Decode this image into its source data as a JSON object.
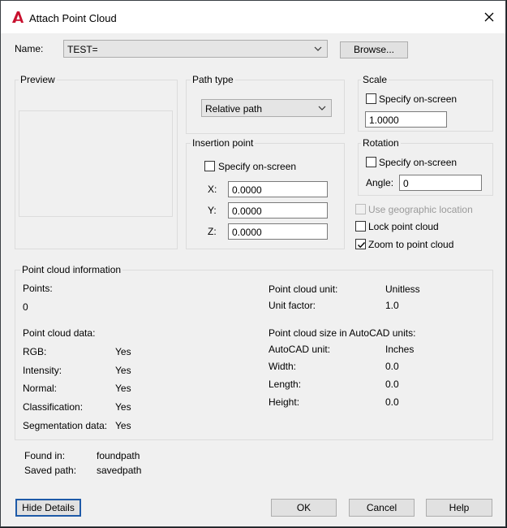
{
  "window": {
    "title": "Attach Point Cloud"
  },
  "name_row": {
    "label": "Name:",
    "value": "TEST=",
    "browse_label": "Browse..."
  },
  "preview": {
    "label": "Preview"
  },
  "path_type": {
    "label": "Path type",
    "value": "Relative path"
  },
  "insertion_point": {
    "label": "Insertion point",
    "specify_label": "Specify on-screen",
    "x_label": "X:",
    "x_value": "0.0000",
    "y_label": "Y:",
    "y_value": "0.0000",
    "z_label": "Z:",
    "z_value": "0.0000"
  },
  "scale": {
    "label": "Scale",
    "specify_label": "Specify on-screen",
    "value": "1.0000"
  },
  "rotation": {
    "label": "Rotation",
    "specify_label": "Specify on-screen",
    "angle_label": "Angle:",
    "angle_value": "0"
  },
  "options": {
    "geo_label": "Use geographic location",
    "lock_label": "Lock point cloud",
    "zoom_label": "Zoom to point cloud",
    "zoom_checked": true
  },
  "info": {
    "label": "Point cloud information",
    "points_label": "Points:",
    "points_value": "0",
    "data_label": "Point cloud data:",
    "rgb_label": "RGB:",
    "rgb_value": "Yes",
    "intensity_label": "Intensity:",
    "intensity_value": "Yes",
    "normal_label": "Normal:",
    "normal_value": "Yes",
    "classification_label": "Classification:",
    "classification_value": "Yes",
    "segmentation_label": "Segmentation data:",
    "segmentation_value": "Yes",
    "unit_label": "Point cloud unit:",
    "unit_value": "Unitless",
    "factor_label": "Unit factor:",
    "factor_value": "1.0",
    "size_label": "Point cloud size in AutoCAD units:",
    "acad_unit_label": "AutoCAD unit:",
    "acad_unit_value": "Inches",
    "width_label": "Width:",
    "width_value": "0.0",
    "length_label": "Length:",
    "length_value": "0.0",
    "height_label": "Height:",
    "height_value": "0.0"
  },
  "paths": {
    "found_label": "Found in:",
    "found_value": "foundpath",
    "saved_label": "Saved path:",
    "saved_value": "savedpath"
  },
  "buttons": {
    "hide_details": "Hide Details",
    "ok": "OK",
    "cancel": "Cancel",
    "help": "Help"
  },
  "colors": {
    "accent": "#1e5aa8",
    "app_icon": "#c8102e"
  }
}
